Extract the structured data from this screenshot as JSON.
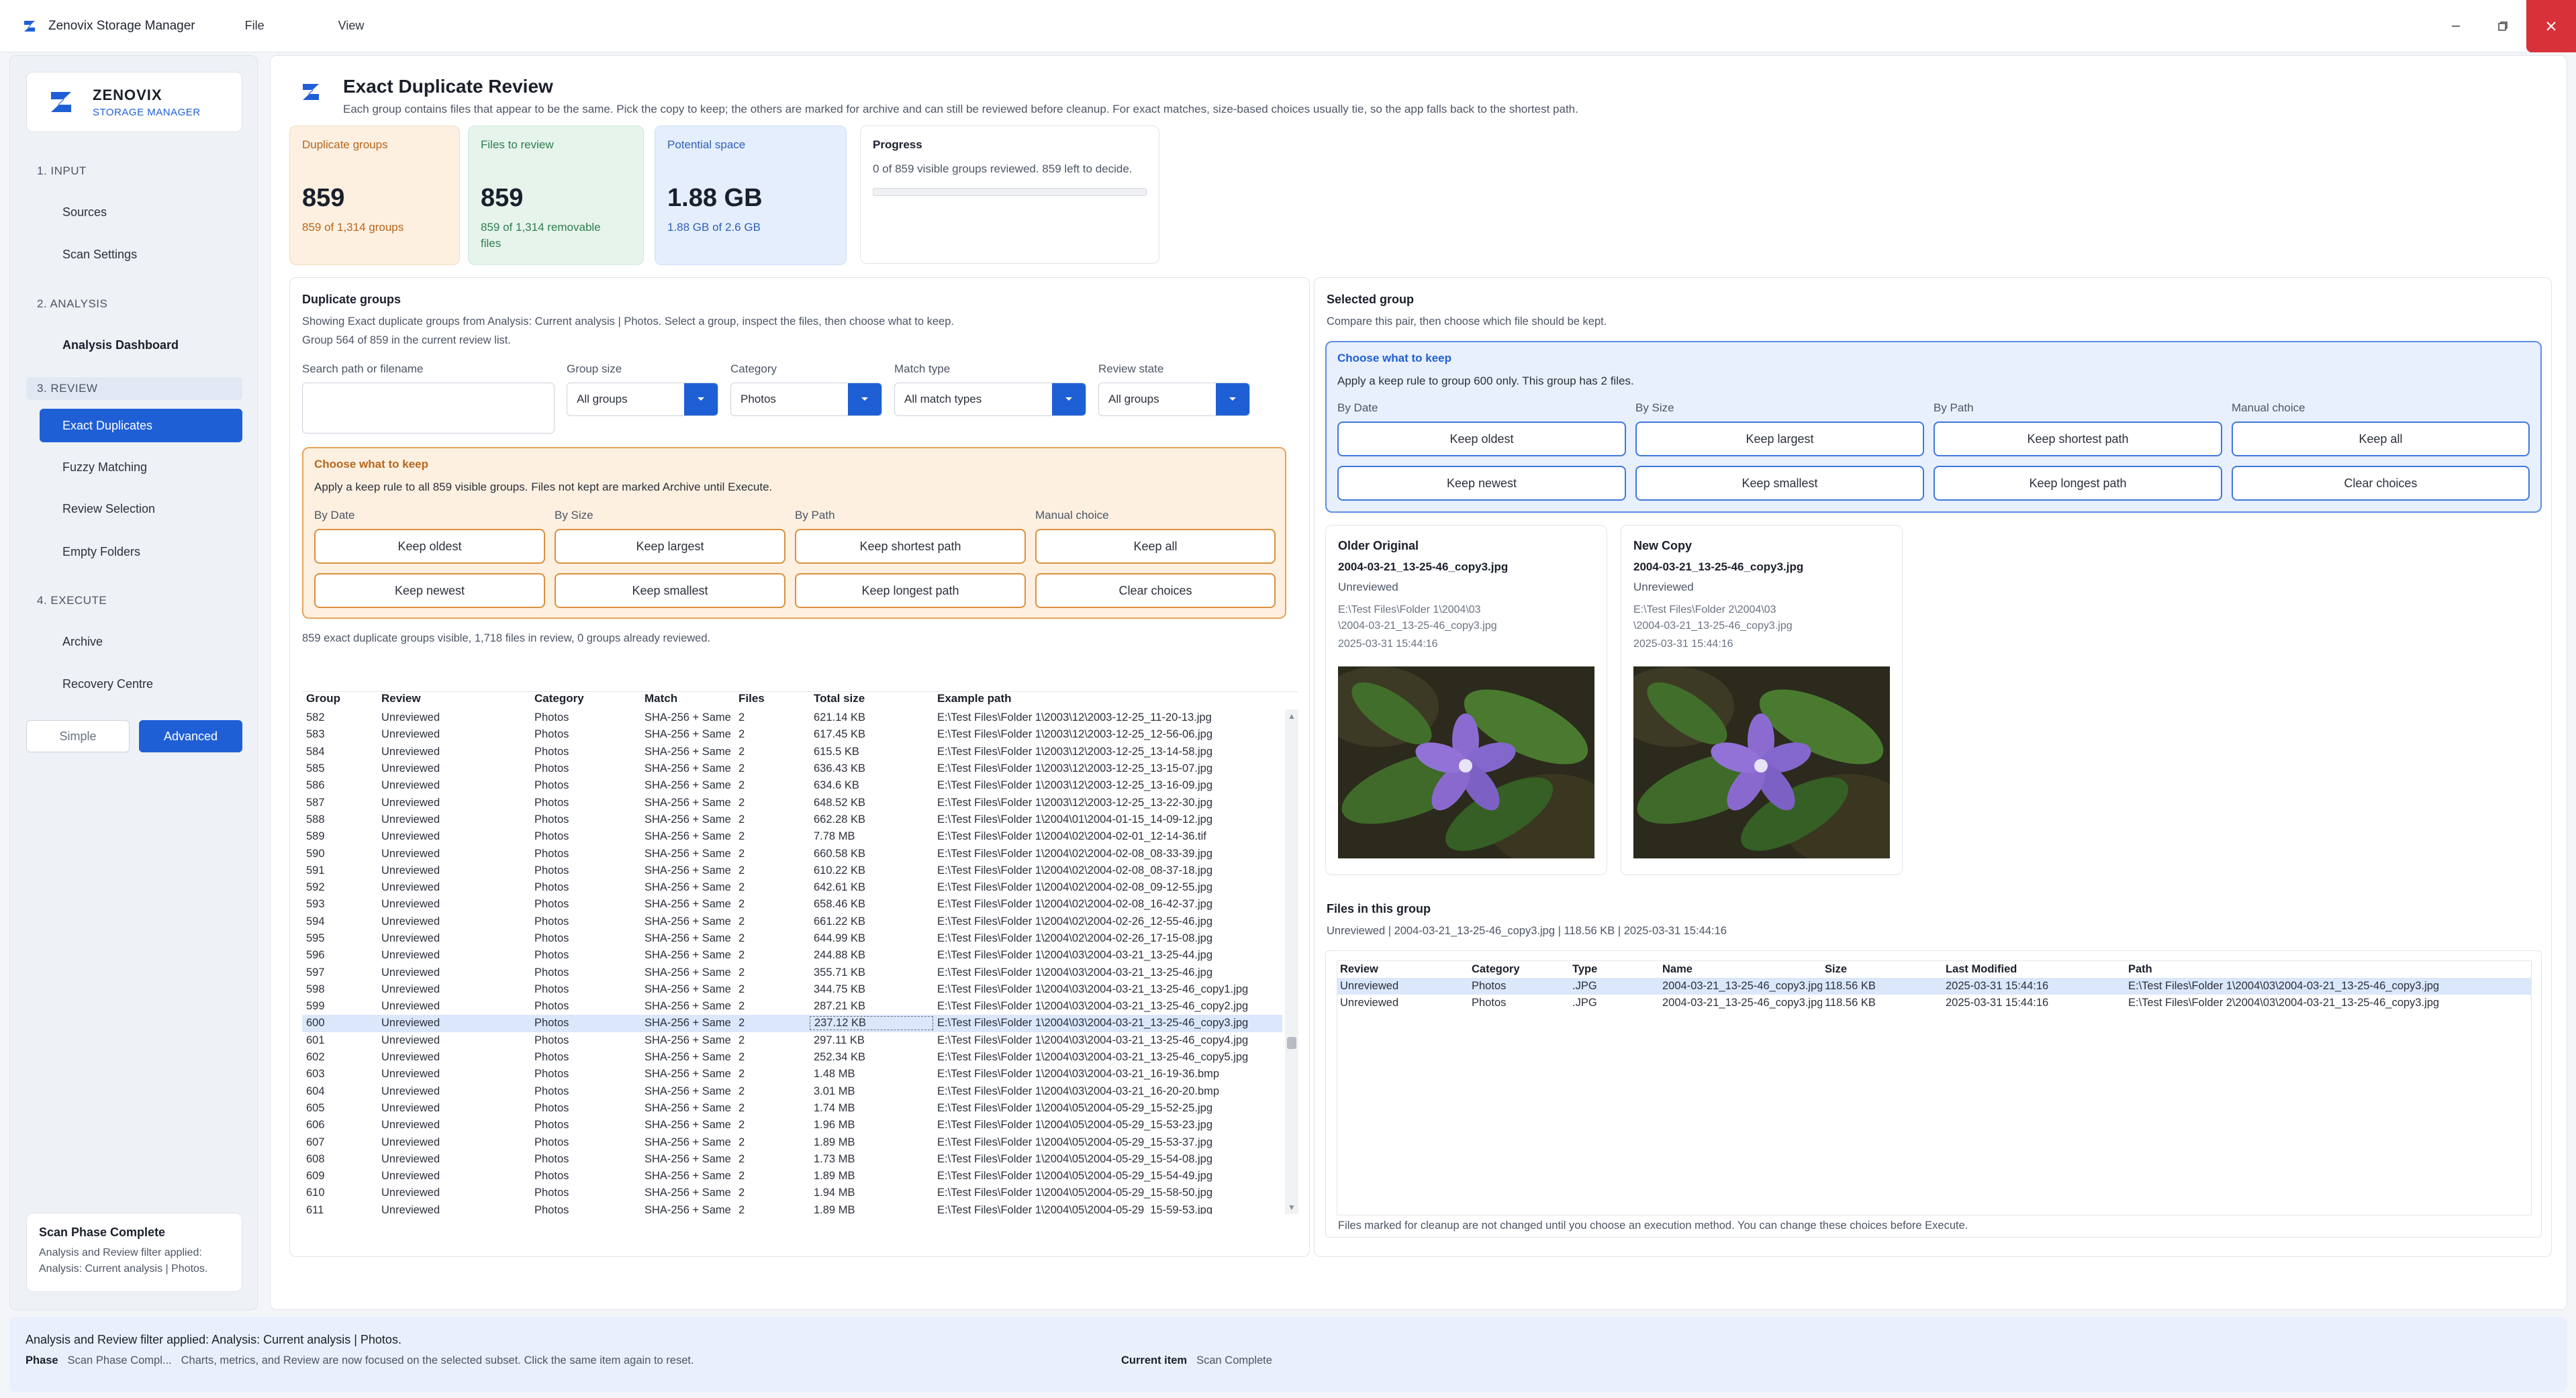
{
  "app": {
    "title": "Zenovix Storage Manager",
    "menus": [
      "File",
      "View"
    ],
    "colors": {
      "accent": "#1f5fd6",
      "close": "#d8313a"
    }
  },
  "sidebar": {
    "brand_name": "ZENOVIX",
    "brand_sub": "STORAGE MANAGER",
    "sections": [
      {
        "label": "1. INPUT",
        "items": [
          "Sources",
          "Scan Settings"
        ]
      },
      {
        "label": "2. ANALYSIS",
        "items": [
          "Analysis Dashboard"
        ]
      },
      {
        "label": "3. REVIEW",
        "items": [
          "Exact Duplicates",
          "Fuzzy Matching",
          "Review Selection",
          "Empty Folders"
        ]
      },
      {
        "label": "4. EXECUTE",
        "items": [
          "Archive",
          "Recovery Centre"
        ]
      }
    ],
    "mode": {
      "simple": "Simple",
      "advanced": "Advanced"
    },
    "phase_card": {
      "title": "Scan Phase Complete",
      "desc_1": "Analysis and Review filter applied:",
      "desc_2": "Analysis: Current analysis | Photos."
    }
  },
  "header": {
    "title": "Exact Duplicate Review",
    "subtitle": "Each group contains files that appear to be the same. Pick the copy to keep; the others are marked for archive and can still be reviewed before cleanup. For exact matches, size-based choices usually tie, so the app falls back to the shortest path."
  },
  "stats": {
    "duplicate_groups": {
      "label": "Duplicate groups",
      "value": "859",
      "caption": "859 of 1,314 groups"
    },
    "files_to_review": {
      "label": "Files to review",
      "value": "859",
      "caption_1": "859 of 1,314 removable",
      "caption_2": "files"
    },
    "potential_space": {
      "label": "Potential space",
      "value": "1.88 GB",
      "caption": "1.88 GB of 2.6 GB"
    },
    "progress": {
      "label": "Progress",
      "caption": "0 of 859 visible groups reviewed. 859 left to decide.",
      "fraction": 0
    }
  },
  "groups_panel": {
    "title": "Duplicate groups",
    "desc": "Showing Exact duplicate groups from Analysis: Current analysis | Photos. Select a group, inspect the files, then choose what to keep.",
    "position": "Group 564 of 859 in the current review list.",
    "filters": {
      "search_label": "Search path or filename",
      "search_value": "",
      "group_size_label": "Group size",
      "group_size_value": "All groups",
      "category_label": "Category",
      "category_value": "Photos",
      "match_type_label": "Match type",
      "match_type_value": "All match types",
      "review_state_label": "Review state",
      "review_state_value": "All groups"
    },
    "choose": {
      "title": "Choose what to keep",
      "desc": "Apply a keep rule to all 859 visible groups. Files not kept are marked Archive until Execute.",
      "col_labels": [
        "By Date",
        "By Size",
        "By Path",
        "Manual choice"
      ],
      "buttons_row1": [
        "Keep oldest",
        "Keep largest",
        "Keep shortest path",
        "Keep all"
      ],
      "buttons_row2": [
        "Keep newest",
        "Keep smallest",
        "Keep longest path",
        "Clear choices"
      ]
    },
    "summary": "859 exact duplicate groups visible, 1,718 files in review, 0 groups already reviewed.",
    "table": {
      "headers": [
        "Group",
        "Review",
        "Category",
        "Match",
        "Files",
        "Total size",
        "Example path"
      ],
      "selected_group": "600",
      "rows": [
        [
          "582",
          "Unreviewed",
          "Photos",
          "SHA-256 + Same",
          "2",
          "621.14 KB",
          "E:\\Test Files\\Folder 1\\2003\\12\\2003-12-25_11-20-13.jpg"
        ],
        [
          "583",
          "Unreviewed",
          "Photos",
          "SHA-256 + Same",
          "2",
          "617.45 KB",
          "E:\\Test Files\\Folder 1\\2003\\12\\2003-12-25_12-56-06.jpg"
        ],
        [
          "584",
          "Unreviewed",
          "Photos",
          "SHA-256 + Same",
          "2",
          "615.5 KB",
          "E:\\Test Files\\Folder 1\\2003\\12\\2003-12-25_13-14-58.jpg"
        ],
        [
          "585",
          "Unreviewed",
          "Photos",
          "SHA-256 + Same",
          "2",
          "636.43 KB",
          "E:\\Test Files\\Folder 1\\2003\\12\\2003-12-25_13-15-07.jpg"
        ],
        [
          "586",
          "Unreviewed",
          "Photos",
          "SHA-256 + Same",
          "2",
          "634.6 KB",
          "E:\\Test Files\\Folder 1\\2003\\12\\2003-12-25_13-16-09.jpg"
        ],
        [
          "587",
          "Unreviewed",
          "Photos",
          "SHA-256 + Same",
          "2",
          "648.52 KB",
          "E:\\Test Files\\Folder 1\\2003\\12\\2003-12-25_13-22-30.jpg"
        ],
        [
          "588",
          "Unreviewed",
          "Photos",
          "SHA-256 + Same",
          "2",
          "662.28 KB",
          "E:\\Test Files\\Folder 1\\2004\\01\\2004-01-15_14-09-12.jpg"
        ],
        [
          "589",
          "Unreviewed",
          "Photos",
          "SHA-256 + Same",
          "2",
          "7.78 MB",
          "E:\\Test Files\\Folder 1\\2004\\02\\2004-02-01_12-14-36.tif"
        ],
        [
          "590",
          "Unreviewed",
          "Photos",
          "SHA-256 + Same",
          "2",
          "660.58 KB",
          "E:\\Test Files\\Folder 1\\2004\\02\\2004-02-08_08-33-39.jpg"
        ],
        [
          "591",
          "Unreviewed",
          "Photos",
          "SHA-256 + Same",
          "2",
          "610.22 KB",
          "E:\\Test Files\\Folder 1\\2004\\02\\2004-02-08_08-37-18.jpg"
        ],
        [
          "592",
          "Unreviewed",
          "Photos",
          "SHA-256 + Same",
          "2",
          "642.61 KB",
          "E:\\Test Files\\Folder 1\\2004\\02\\2004-02-08_09-12-55.jpg"
        ],
        [
          "593",
          "Unreviewed",
          "Photos",
          "SHA-256 + Same",
          "2",
          "658.46 KB",
          "E:\\Test Files\\Folder 1\\2004\\02\\2004-02-08_16-42-37.jpg"
        ],
        [
          "594",
          "Unreviewed",
          "Photos",
          "SHA-256 + Same",
          "2",
          "661.22 KB",
          "E:\\Test Files\\Folder 1\\2004\\02\\2004-02-26_12-55-46.jpg"
        ],
        [
          "595",
          "Unreviewed",
          "Photos",
          "SHA-256 + Same",
          "2",
          "644.99 KB",
          "E:\\Test Files\\Folder 1\\2004\\02\\2004-02-26_17-15-08.jpg"
        ],
        [
          "596",
          "Unreviewed",
          "Photos",
          "SHA-256 + Same",
          "2",
          "244.88 KB",
          "E:\\Test Files\\Folder 1\\2004\\03\\2004-03-21_13-25-44.jpg"
        ],
        [
          "597",
          "Unreviewed",
          "Photos",
          "SHA-256 + Same",
          "2",
          "355.71 KB",
          "E:\\Test Files\\Folder 1\\2004\\03\\2004-03-21_13-25-46.jpg"
        ],
        [
          "598",
          "Unreviewed",
          "Photos",
          "SHA-256 + Same",
          "2",
          "344.75 KB",
          "E:\\Test Files\\Folder 1\\2004\\03\\2004-03-21_13-25-46_copy1.jpg"
        ],
        [
          "599",
          "Unreviewed",
          "Photos",
          "SHA-256 + Same",
          "2",
          "287.21 KB",
          "E:\\Test Files\\Folder 1\\2004\\03\\2004-03-21_13-25-46_copy2.jpg"
        ],
        [
          "600",
          "Unreviewed",
          "Photos",
          "SHA-256 + Same",
          "2",
          "237.12 KB",
          "E:\\Test Files\\Folder 1\\2004\\03\\2004-03-21_13-25-46_copy3.jpg"
        ],
        [
          "601",
          "Unreviewed",
          "Photos",
          "SHA-256 + Same",
          "2",
          "297.11 KB",
          "E:\\Test Files\\Folder 1\\2004\\03\\2004-03-21_13-25-46_copy4.jpg"
        ],
        [
          "602",
          "Unreviewed",
          "Photos",
          "SHA-256 + Same",
          "2",
          "252.34 KB",
          "E:\\Test Files\\Folder 1\\2004\\03\\2004-03-21_13-25-46_copy5.jpg"
        ],
        [
          "603",
          "Unreviewed",
          "Photos",
          "SHA-256 + Same",
          "2",
          "1.48 MB",
          "E:\\Test Files\\Folder 1\\2004\\03\\2004-03-21_16-19-36.bmp"
        ],
        [
          "604",
          "Unreviewed",
          "Photos",
          "SHA-256 + Same",
          "2",
          "3.01 MB",
          "E:\\Test Files\\Folder 1\\2004\\03\\2004-03-21_16-20-20.bmp"
        ],
        [
          "605",
          "Unreviewed",
          "Photos",
          "SHA-256 + Same",
          "2",
          "1.74 MB",
          "E:\\Test Files\\Folder 1\\2004\\05\\2004-05-29_15-52-25.jpg"
        ],
        [
          "606",
          "Unreviewed",
          "Photos",
          "SHA-256 + Same",
          "2",
          "1.96 MB",
          "E:\\Test Files\\Folder 1\\2004\\05\\2004-05-29_15-53-23.jpg"
        ],
        [
          "607",
          "Unreviewed",
          "Photos",
          "SHA-256 + Same",
          "2",
          "1.89 MB",
          "E:\\Test Files\\Folder 1\\2004\\05\\2004-05-29_15-53-37.jpg"
        ],
        [
          "608",
          "Unreviewed",
          "Photos",
          "SHA-256 + Same",
          "2",
          "1.73 MB",
          "E:\\Test Files\\Folder 1\\2004\\05\\2004-05-29_15-54-08.jpg"
        ],
        [
          "609",
          "Unreviewed",
          "Photos",
          "SHA-256 + Same",
          "2",
          "1.89 MB",
          "E:\\Test Files\\Folder 1\\2004\\05\\2004-05-29_15-54-49.jpg"
        ],
        [
          "610",
          "Unreviewed",
          "Photos",
          "SHA-256 + Same",
          "2",
          "1.94 MB",
          "E:\\Test Files\\Folder 1\\2004\\05\\2004-05-29_15-58-50.jpg"
        ],
        [
          "611",
          "Unreviewed",
          "Photos",
          "SHA-256 + Same",
          "2",
          "1.89 MB",
          "E:\\Test Files\\Folder 1\\2004\\05\\2004-05-29_15-59-53.jpg"
        ]
      ]
    }
  },
  "selected_panel": {
    "title": "Selected group",
    "desc": "Compare this pair, then choose which file should be kept.",
    "choose": {
      "title": "Choose what to keep",
      "desc": "Apply a keep rule to group 600 only. This group has 2 files.",
      "col_labels": [
        "By Date",
        "By Size",
        "By Path",
        "Manual choice"
      ],
      "buttons_row1": [
        "Keep oldest",
        "Keep largest",
        "Keep shortest path",
        "Keep all"
      ],
      "buttons_row2": [
        "Keep newest",
        "Keep smallest",
        "Keep longest path",
        "Clear choices"
      ]
    },
    "cards": [
      {
        "title": "Older Original",
        "file": "2004-03-21_13-25-46_copy3.jpg",
        "status": "Unreviewed",
        "path_1": "E:\\Test Files\\Folder 1\\2004\\03",
        "path_2": "\\2004-03-21_13-25-46_copy3.jpg",
        "date": "2025-03-31 15:44:16"
      },
      {
        "title": "New Copy",
        "file": "2004-03-21_13-25-46_copy3.jpg",
        "status": "Unreviewed",
        "path_1": "E:\\Test Files\\Folder 2\\2004\\03",
        "path_2": "\\2004-03-21_13-25-46_copy3.jpg",
        "date": "2025-03-31 15:44:16"
      }
    ],
    "files_title": "Files in this group",
    "files_summary": "Unreviewed  |  2004-03-21_13-25-46_copy3.jpg  |  118.56 KB  |  2025-03-31 15:44:16",
    "files_table": {
      "headers": [
        "Review",
        "Category",
        "Type",
        "Name",
        "Size",
        "Last Modified",
        "Path"
      ],
      "rows": [
        [
          "Unreviewed",
          "Photos",
          ".JPG",
          "2004-03-21_13-25-46_copy3.jpg",
          "118.56 KB",
          "2025-03-31 15:44:16",
          "E:\\Test Files\\Folder 1\\2004\\03\\2004-03-21_13-25-46_copy3.jpg"
        ],
        [
          "Unreviewed",
          "Photos",
          ".JPG",
          "2004-03-21_13-25-46_copy3.jpg",
          "118.56 KB",
          "2025-03-31 15:44:16",
          "E:\\Test Files\\Folder 2\\2004\\03\\2004-03-21_13-25-46_copy3.jpg"
        ]
      ]
    },
    "files_note": "Files marked for cleanup are not changed until you choose an execution method. You can change these choices before Execute."
  },
  "statusbar": {
    "message": "Analysis and Review filter applied: Analysis: Current analysis | Photos.",
    "phase_label": "Phase",
    "phase_value": "Scan Phase Compl...",
    "phase_desc": "Charts, metrics, and Review are now focused on the selected subset. Click the same item again to reset.",
    "current_label": "Current item",
    "current_value": "Scan Complete"
  },
  "icons": [
    "zenovix-logo-icon",
    "minimize-icon",
    "restore-icon",
    "close-icon",
    "chevron-down-icon",
    "scroll-up-icon",
    "scroll-down-icon"
  ]
}
